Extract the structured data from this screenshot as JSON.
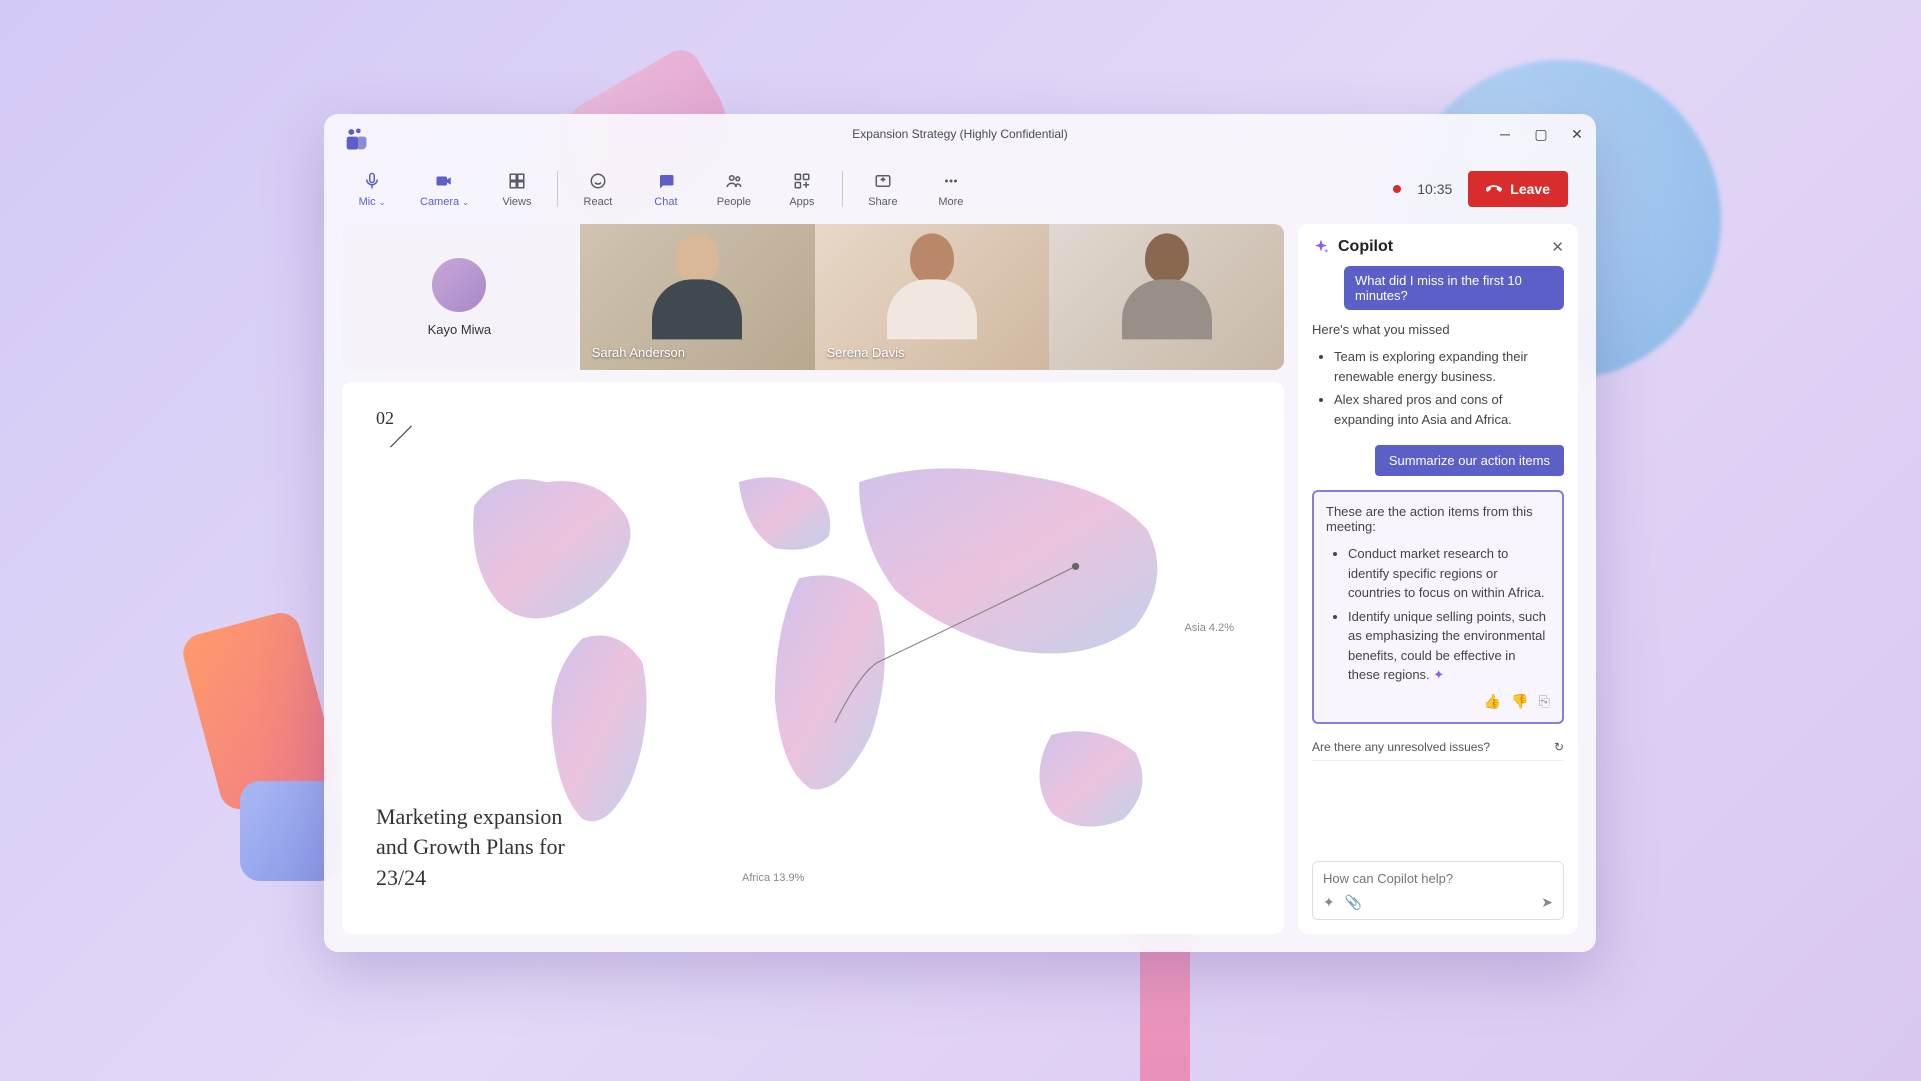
{
  "window": {
    "title": "Expansion Strategy (Highly Confidential)"
  },
  "toolbar": {
    "mic": "Mic",
    "camera": "Camera",
    "views": "Views",
    "react": "React",
    "chat": "Chat",
    "people": "People",
    "apps": "Apps",
    "share": "Share",
    "more": "More",
    "timer": "10:35",
    "leave": "Leave"
  },
  "participants": [
    {
      "name": "Kayo Miwa"
    },
    {
      "name": "Sarah Anderson"
    },
    {
      "name": "Serena Davis"
    },
    {
      "name": ""
    }
  ],
  "slide": {
    "number": "02",
    "title": "Marketing expansion and Growth Plans for 23/24",
    "labels": {
      "asia": "Asia 4.2%",
      "africa": "Africa 13.9%"
    }
  },
  "copilot": {
    "title": "Copilot",
    "user_q1": "What did I miss in the first 10 minutes?",
    "response1_intro": "Here's what you missed",
    "response1_items": [
      "Team is exploring expanding their renewable energy business.",
      "Alex shared pros and cons of expanding into Asia and Africa."
    ],
    "action_btn": "Summarize our action items",
    "response2_intro": "These are the action items from this meeting:",
    "response2_items": [
      "Conduct market research to identify specific regions or countries to focus on within Africa.",
      "Identify unique selling points, such as emphasizing the environmental benefits, could be effective in these regions."
    ],
    "suggestion": "Are there any unresolved issues?",
    "input_placeholder": "How can Copilot help?"
  }
}
